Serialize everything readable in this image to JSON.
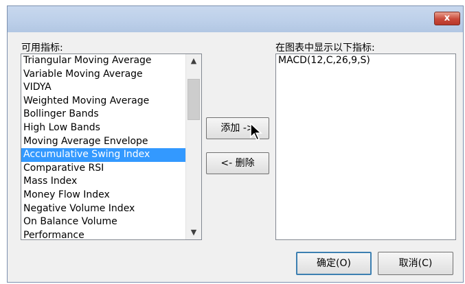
{
  "window": {
    "close_glyph": "x"
  },
  "available": {
    "label": "可用指标:",
    "items": [
      "Triangular Moving Average",
      "Variable Moving Average",
      "VIDYA",
      "Weighted Moving Average",
      "Bollinger Bands",
      "High Low Bands",
      "Moving Average Envelope",
      "Accumulative Swing Index",
      "Comparative RSI",
      "Mass Index",
      "Money Flow Index",
      "Negative Volume Index",
      "On Balance Volume",
      "Performance"
    ],
    "selected": "Accumulative Swing Index"
  },
  "shown": {
    "label": "在图表中显示以下指标:",
    "items": [
      "MACD(12,C,26,9,S)"
    ]
  },
  "buttons": {
    "add": "添加 ->",
    "remove": "<- 删除",
    "ok": "确定(O)",
    "cancel": "取消(C)"
  },
  "icons": {
    "scroll_up": "chevron-up-icon",
    "scroll_down": "chevron-down-icon",
    "cursor": "mouse-pointer-icon"
  }
}
